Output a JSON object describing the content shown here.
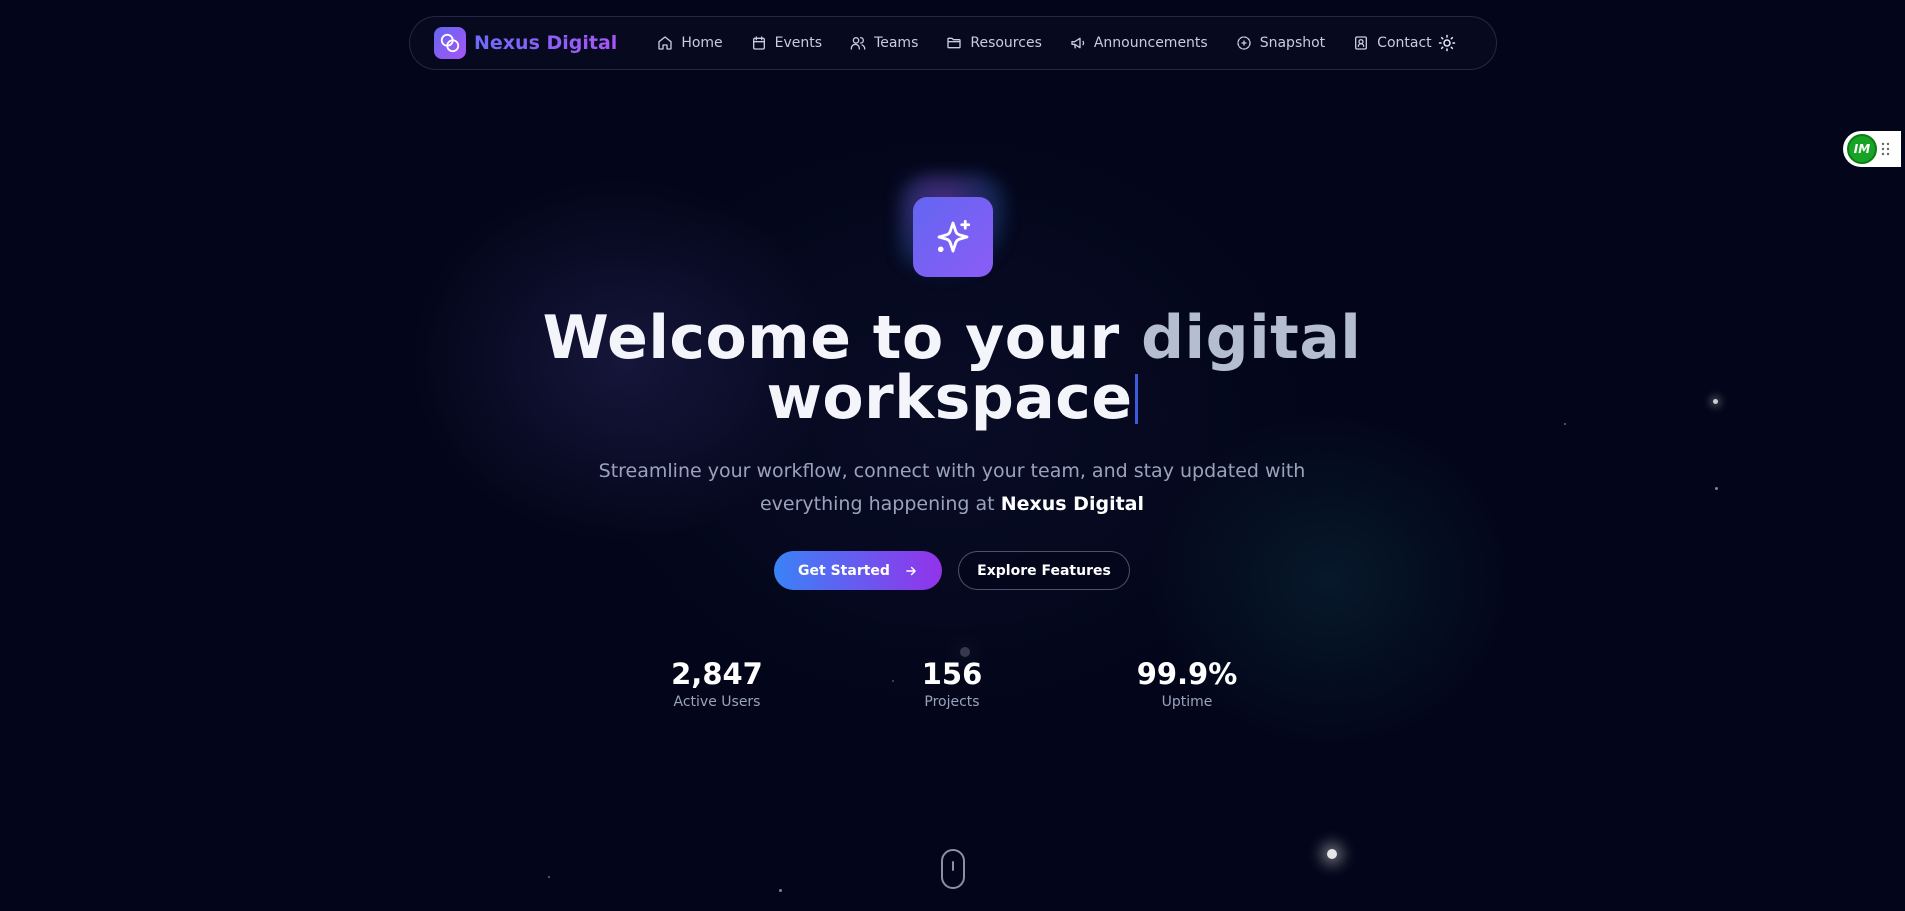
{
  "nav": {
    "brand": "Nexus Digital",
    "items": [
      {
        "label": "Home",
        "icon": "home-icon"
      },
      {
        "label": "Events",
        "icon": "calendar-icon"
      },
      {
        "label": "Teams",
        "icon": "users-icon"
      },
      {
        "label": "Resources",
        "icon": "folder-icon"
      },
      {
        "label": "Announcements",
        "icon": "megaphone-icon"
      },
      {
        "label": "Snapshot",
        "icon": "snapshot-icon"
      },
      {
        "label": "Contact",
        "icon": "contact-icon"
      }
    ],
    "theme_toggle_icon": "sun-icon"
  },
  "widget": {
    "badge": "IM"
  },
  "hero": {
    "icon": "sparkles-icon",
    "headline_part1": "Welcome to your ",
    "headline_part2": "digital",
    "headline_part3": "workspace",
    "subtitle_text": "Streamline your workflow, connect with your team, and stay updated with everything happening at",
    "subtitle_strong": "Nexus Digital",
    "primary_button": "Get Started",
    "secondary_button": "Explore Features"
  },
  "stats": [
    {
      "value": "2,847",
      "label": "Active Users"
    },
    {
      "value": "156",
      "label": "Projects"
    },
    {
      "value": "99.9%",
      "label": "Uptime"
    }
  ],
  "colors": {
    "background": "#03061a",
    "accent_blue": "#3b82f6",
    "accent_purple": "#9333ea",
    "brand_gradient_start": "#6366f1",
    "brand_gradient_end": "#a855f7"
  }
}
